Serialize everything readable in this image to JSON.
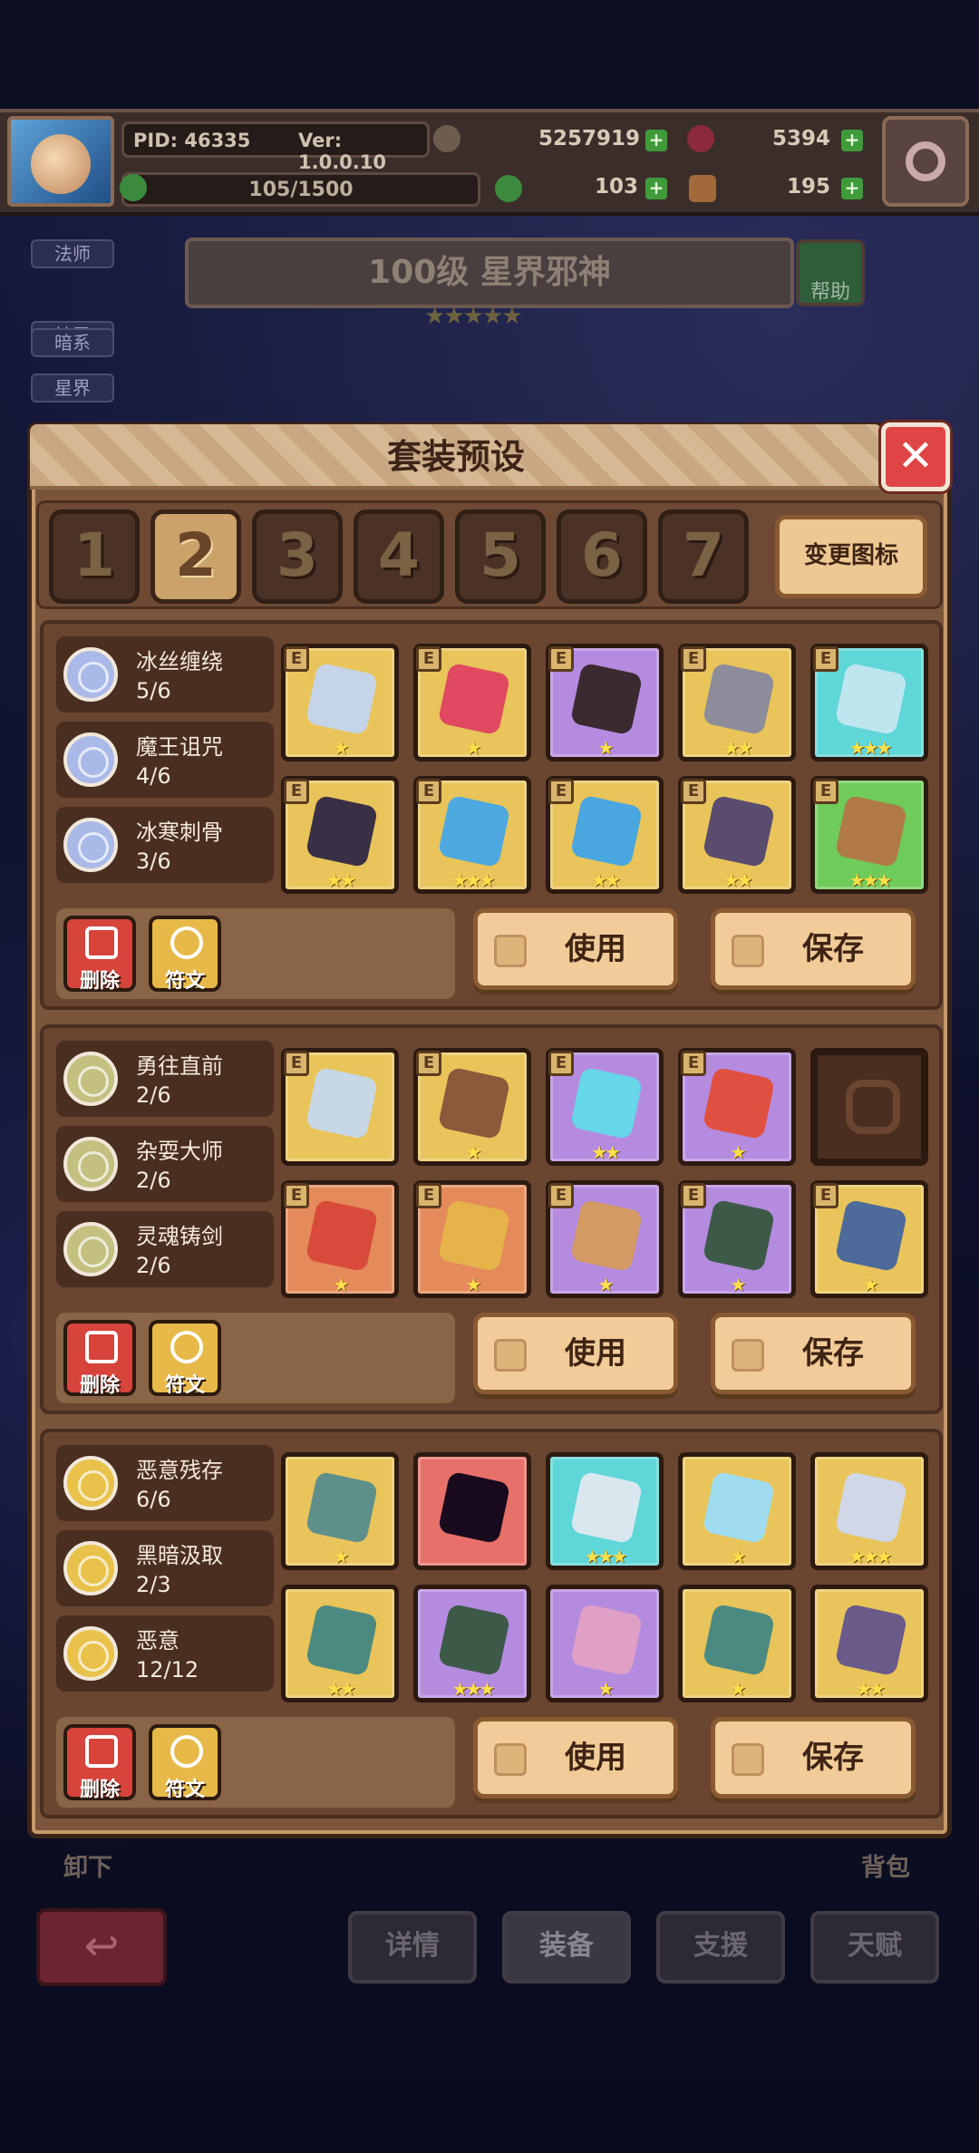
{
  "hud": {
    "pid": "PID: 46335",
    "version": "Ver: 1.0.0.10",
    "gold": "5257919",
    "gems": "5394",
    "stamina": "105/1500",
    "clover": "103",
    "keys": "195"
  },
  "hero": {
    "tags": [
      "法师",
      "神灵",
      "暗系",
      "星界"
    ],
    "title": "100级 星界邪神",
    "stars": "★★★★★",
    "help_label": "帮助"
  },
  "modal": {
    "title": "套装预设",
    "close_label": "✕",
    "tabs": [
      "1",
      "2",
      "3",
      "4",
      "5",
      "6",
      "7"
    ],
    "active_tab": "2",
    "change_icon_label": "变更图标"
  },
  "presets": [
    {
      "sets": [
        {
          "name": "冰丝缠绕",
          "count": "5/6",
          "color": "#a9b9e8"
        },
        {
          "name": "魔王诅咒",
          "count": "4/6",
          "color": "#a9b9e8"
        },
        {
          "name": "冰寒刺骨",
          "count": "3/6",
          "color": "#a9b9e8"
        }
      ],
      "items": [
        {
          "icon": "staff-icon",
          "bg": "#e8c45a",
          "gear": "#c6d4e8",
          "stars": "★",
          "equipped": true
        },
        {
          "icon": "bear-doll-icon",
          "bg": "#e8c45a",
          "gear": "#e0495f",
          "stars": "★",
          "equipped": true
        },
        {
          "icon": "necklace-icon",
          "bg": "#b58be0",
          "gear": "#3a2a30",
          "stars": "★",
          "equipped": true
        },
        {
          "icon": "gem-icon",
          "bg": "#e8c45a",
          "gear": "#8c8c9a",
          "stars": "★★",
          "equipped": true
        },
        {
          "icon": "helmet-icon",
          "bg": "#5fd6d8",
          "gear": "#bfe6ef",
          "stars": "★★★",
          "equipped": true
        },
        {
          "icon": "shoulder-icon",
          "bg": "#e8c45a",
          "gear": "#3a3046",
          "stars": "★★",
          "equipped": true
        },
        {
          "icon": "armor-icon",
          "bg": "#e8c45a",
          "gear": "#4ea9e0",
          "stars": "★★★",
          "equipped": true
        },
        {
          "icon": "cape-icon",
          "bg": "#e8c45a",
          "gear": "#49a6df",
          "stars": "★★",
          "equipped": true
        },
        {
          "icon": "bracer-icon",
          "bg": "#e8c45a",
          "gear": "#5a4c6e",
          "stars": "★★",
          "equipped": true
        },
        {
          "icon": "boots-icon",
          "bg": "#6fcb5a",
          "gear": "#b07a46",
          "stars": "★★★",
          "equipped": true
        }
      ],
      "delete_label": "删除",
      "rune_label": "符文",
      "use_label": "使用",
      "save_label": "保存"
    },
    {
      "sets": [
        {
          "name": "勇往直前",
          "count": "2/6",
          "color": "#c3c080"
        },
        {
          "name": "杂耍大师",
          "count": "2/6",
          "color": "#c3c080"
        },
        {
          "name": "灵魂铸剑",
          "count": "2/6",
          "color": "#c3c080"
        }
      ],
      "items": [
        {
          "icon": "spear-icon",
          "bg": "#e8c45a",
          "gear": "#c8d7e6",
          "stars": "",
          "equipped": true
        },
        {
          "icon": "drum-icon",
          "bg": "#e8c45a",
          "gear": "#8a5a3a",
          "stars": "★",
          "equipped": true
        },
        {
          "icon": "heart-pendant-icon",
          "bg": "#b58be0",
          "gear": "#66d6e8",
          "stars": "★★",
          "equipped": true
        },
        {
          "icon": "shell-icon",
          "bg": "#b58be0",
          "gear": "#e05040",
          "stars": "★",
          "equipped": true
        },
        {
          "icon": "empty-ring-slot",
          "bg": "#4a2e1f",
          "gear": "",
          "stars": "",
          "equipped": false
        },
        {
          "icon": "crown-icon",
          "bg": "#e58a5a",
          "gear": "#d84a3a",
          "stars": "★",
          "equipped": true
        },
        {
          "icon": "robe-icon",
          "bg": "#e58a5a",
          "gear": "#e6b24a",
          "stars": "★",
          "equipped": true
        },
        {
          "icon": "glove-icon",
          "bg": "#b58be0",
          "gear": "#d39a64",
          "stars": "★",
          "equipped": true
        },
        {
          "icon": "dark-cape-icon",
          "bg": "#b58be0",
          "gear": "#3d5a48",
          "stars": "★",
          "equipped": true
        },
        {
          "icon": "sneakers-icon",
          "bg": "#e8c45a",
          "gear": "#4d6a9a",
          "stars": "★",
          "equipped": true
        }
      ],
      "delete_label": "删除",
      "rune_label": "符文",
      "use_label": "使用",
      "save_label": "保存"
    },
    {
      "sets": [
        {
          "name": "恶意残存",
          "count": "6/6",
          "color": "#e8c24a"
        },
        {
          "name": "黑暗汲取",
          "count": "2/3",
          "color": "#e8c24a"
        },
        {
          "name": "恶意",
          "count": "12/12",
          "color": "#e8c24a"
        }
      ],
      "items": [
        {
          "icon": "mace-icon",
          "bg": "#e8c45a",
          "gear": "#5f8f8a",
          "stars": "★",
          "equipped": false
        },
        {
          "icon": "dark-orb-icon",
          "bg": "#e8706a",
          "gear": "#1a0a1e",
          "stars": "",
          "equipped": false
        },
        {
          "icon": "crystal-necklace-icon",
          "bg": "#5fd6d8",
          "gear": "#d9e8ef",
          "stars": "★★★",
          "equipped": false
        },
        {
          "icon": "ice-gem-icon",
          "bg": "#e8c45a",
          "gear": "#9fdcef",
          "stars": "★",
          "equipped": false
        },
        {
          "icon": "silver-helm-icon",
          "bg": "#e8c45a",
          "gear": "#d0d8e8",
          "stars": "★★★",
          "equipped": false
        },
        {
          "icon": "teal-armor-icon",
          "bg": "#e8c45a",
          "gear": "#4b8a80",
          "stars": "★★",
          "equipped": false
        },
        {
          "icon": "green-cape-icon",
          "bg": "#b58be0",
          "gear": "#3d5a48",
          "stars": "★★★",
          "equipped": false
        },
        {
          "icon": "pink-glove-icon",
          "bg": "#b58be0",
          "gear": "#e0a0c6",
          "stars": "★",
          "equipped": false
        },
        {
          "icon": "belt-icon",
          "bg": "#e8c45a",
          "gear": "#4b8a80",
          "stars": "★",
          "equipped": false
        },
        {
          "icon": "purple-boots-icon",
          "bg": "#e8c45a",
          "gear": "#6a5a8a",
          "stars": "★★",
          "equipped": false
        }
      ],
      "delete_label": "删除",
      "rune_label": "符文",
      "use_label": "使用",
      "save_label": "保存"
    }
  ],
  "bottom": {
    "unequip_label": "卸下",
    "bag_label": "背包",
    "back_label": "↩",
    "nav": [
      "详情",
      "装备",
      "支援",
      "天赋"
    ]
  }
}
